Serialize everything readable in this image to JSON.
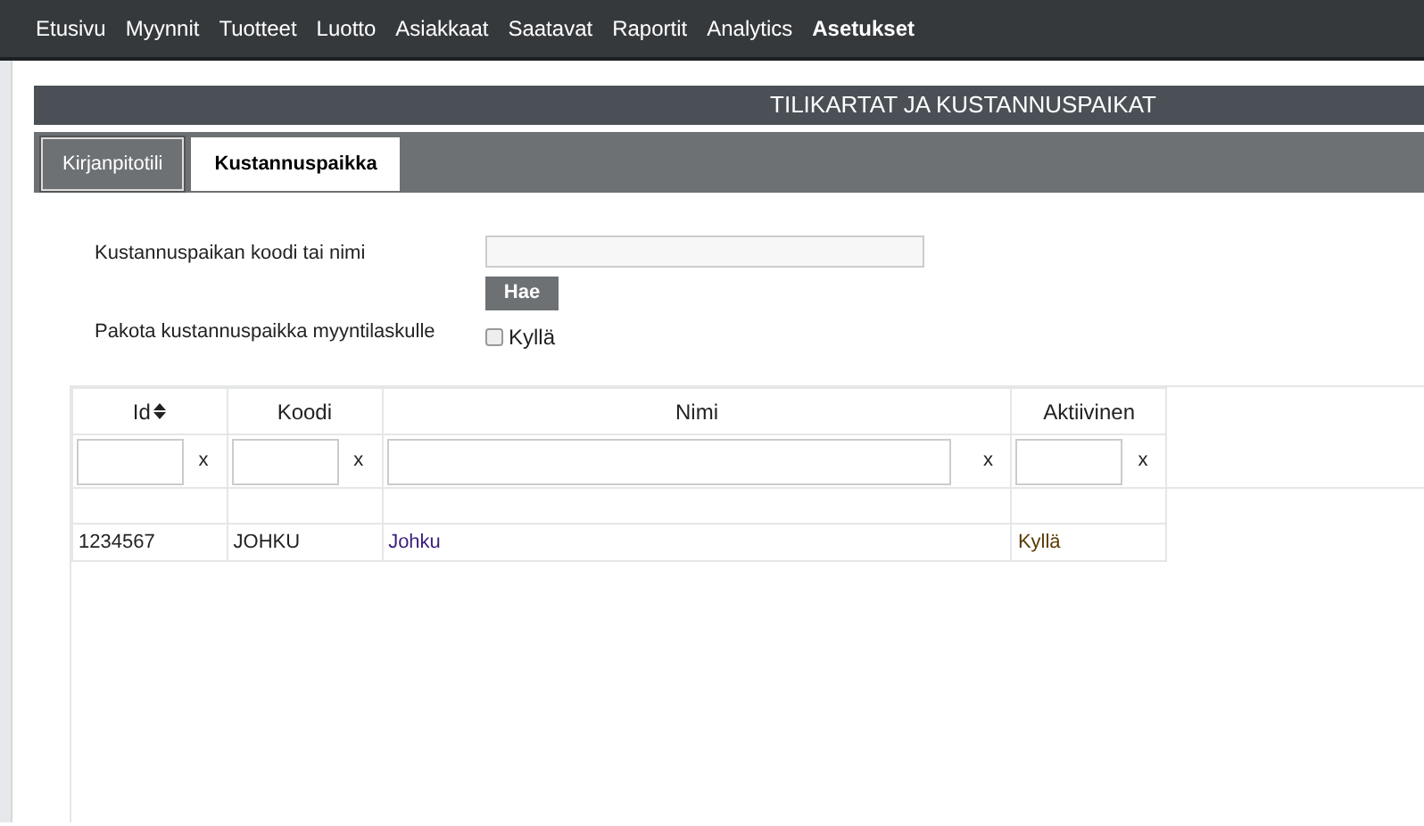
{
  "nav": [
    {
      "label": "Etusivu",
      "selected": false
    },
    {
      "label": "Myynnit",
      "selected": false
    },
    {
      "label": "Tuotteet",
      "selected": false
    },
    {
      "label": "Luotto",
      "selected": false
    },
    {
      "label": "Asiakkaat",
      "selected": false
    },
    {
      "label": "Saatavat",
      "selected": false
    },
    {
      "label": "Raportit",
      "selected": false
    },
    {
      "label": "Analytics",
      "selected": false
    },
    {
      "label": "Asetukset",
      "selected": true
    }
  ],
  "panel": {
    "title": "TILIKARTAT JA KUSTANNUSPAIKAT",
    "tabs": [
      {
        "label": "Kirjanpitotili",
        "selected": false
      },
      {
        "label": "Kustannuspaikka",
        "selected": true
      }
    ],
    "search": {
      "label": "Kustannuspaikan koodi tai nimi",
      "button": "Hae"
    },
    "force": {
      "label": "Pakota kustannuspaikka myyntilaskulle",
      "option": "Kyllä",
      "checked": false
    }
  },
  "table": {
    "columns": [
      {
        "label": "Id",
        "sortable": true,
        "clear": "x"
      },
      {
        "label": "Koodi",
        "sortable": false,
        "clear": "x"
      },
      {
        "label": "Nimi",
        "sortable": false,
        "clear": "x"
      },
      {
        "label": "Aktiivinen",
        "sortable": false,
        "clear": "x"
      }
    ],
    "rows": [
      [
        "1234567",
        "JOHKU",
        "Johku",
        "Kyllä"
      ]
    ]
  }
}
